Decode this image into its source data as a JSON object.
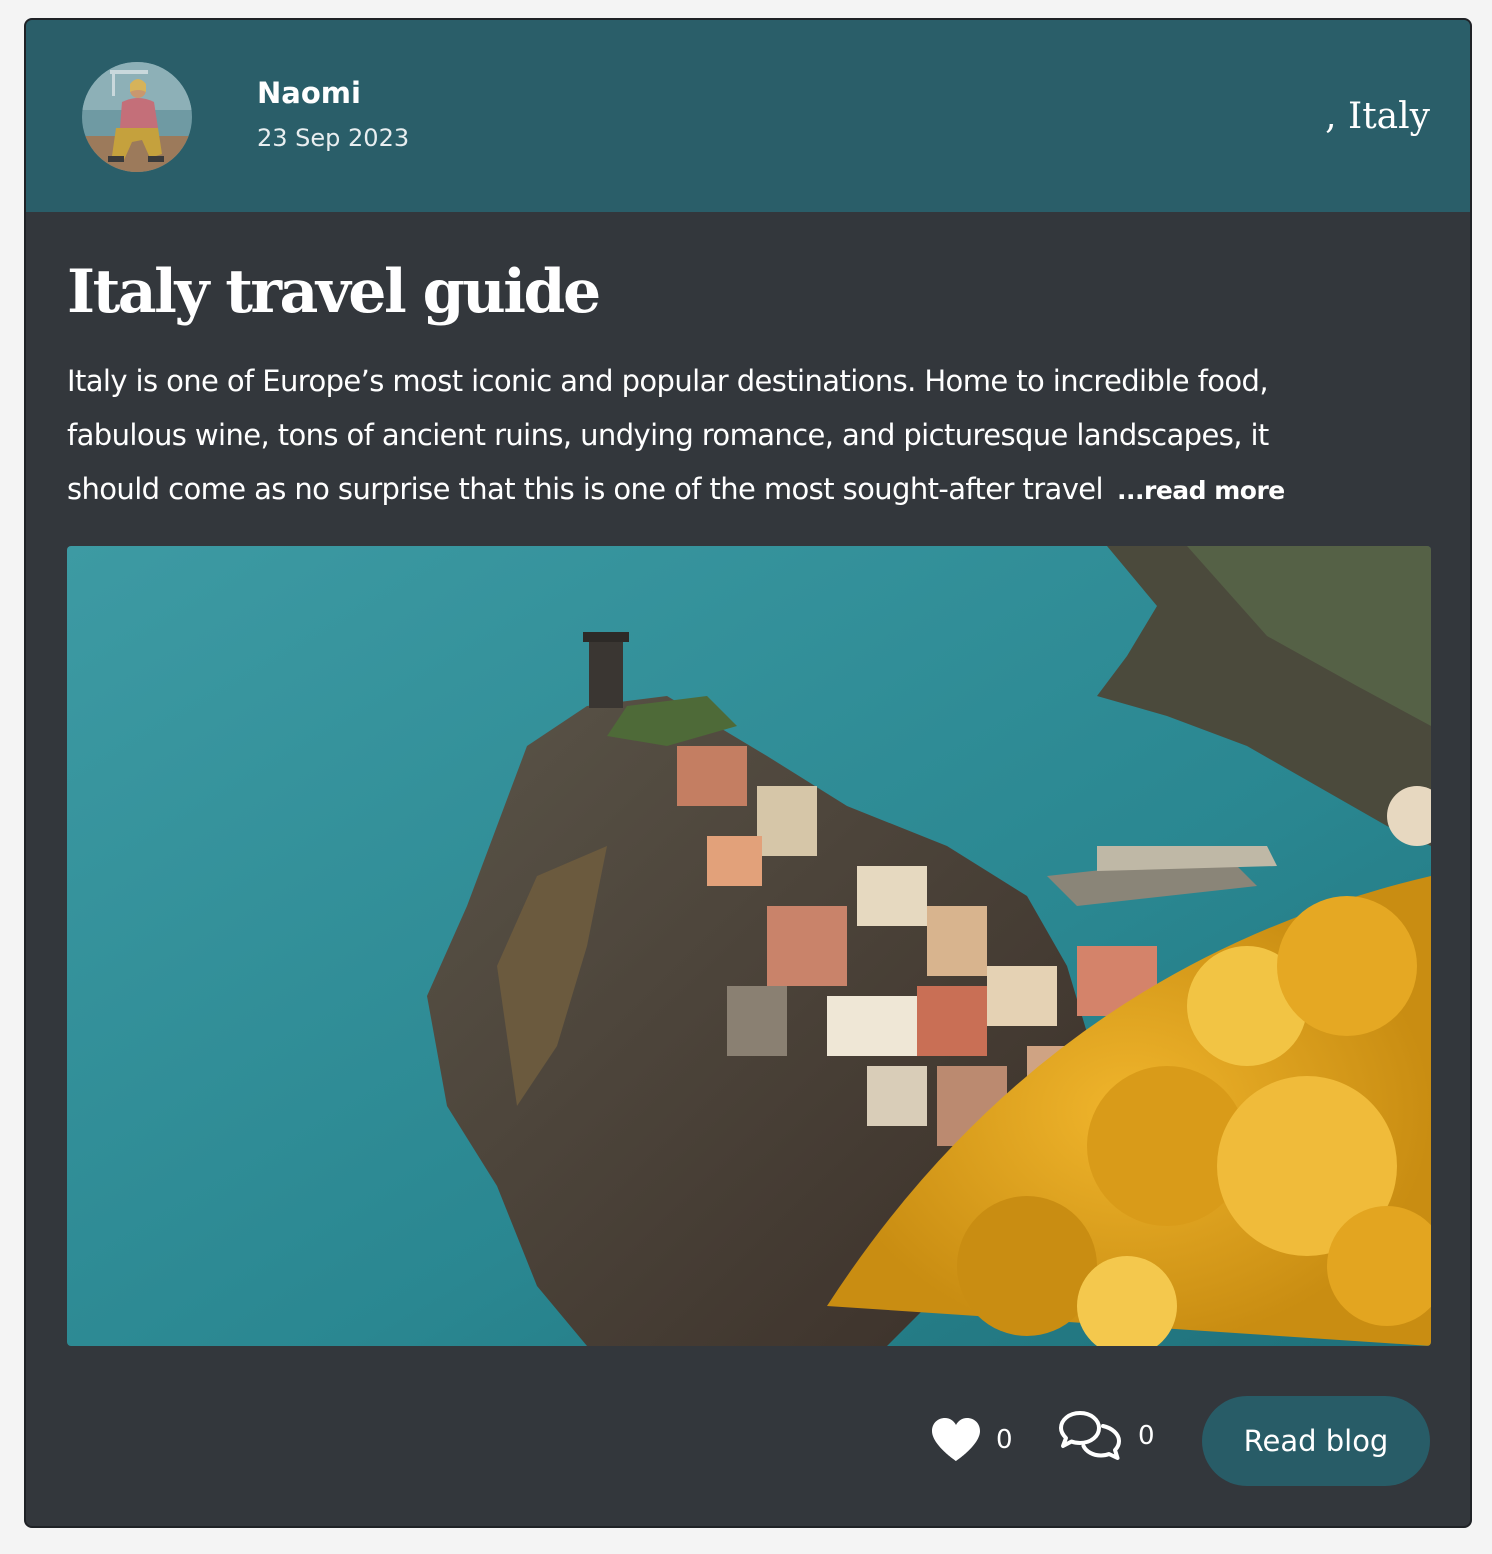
{
  "post": {
    "author": {
      "name": "Naomi",
      "date": "23 Sep 2023"
    },
    "location": ", Italy",
    "title": "Italy travel guide",
    "excerpt_lines": [
      "Italy is one of Europe’s most iconic and popular destinations. Home to incredible food,",
      "fabulous wine, tons of ancient ruins, undying romance, and picturesque landscapes, it",
      "should come as no surprise that this is one of the most sought-after travel"
    ],
    "read_more_label": "...read more",
    "likes": "0",
    "comments": "0",
    "read_blog_label": "Read blog"
  },
  "icons": {
    "like": "heart-icon",
    "comment": "comments-icon"
  },
  "colors": {
    "header_bg": "#2a5e69",
    "card_bg": "#33373c",
    "button_bg": "#285c67",
    "text": "#ffffff"
  }
}
